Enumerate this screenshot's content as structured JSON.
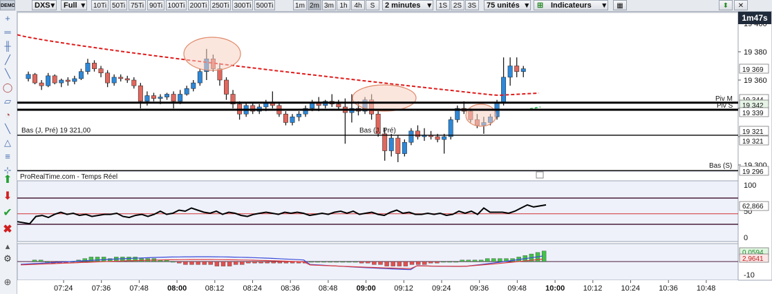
{
  "toolbar": {
    "demo_badge": "DEMO",
    "symbol": "DXS",
    "history": "Full",
    "tick_buttons": [
      "10Ti",
      "50Ti",
      "75Ti",
      "90Ti",
      "100Ti",
      "200Ti",
      "250Ti",
      "300Ti",
      "500Ti"
    ],
    "time_buttons": [
      "1m",
      "2m",
      "3m",
      "1h",
      "4h",
      "S"
    ],
    "active_time": "2m",
    "interval": "2 minutes",
    "second_buttons": [
      "1S",
      "2S",
      "3S"
    ],
    "units": "75 unités",
    "indicators": "Indicateurs"
  },
  "timer": "1m47s",
  "price_panel": {
    "axis_labels": [
      "19 400",
      "19 380",
      "19 360",
      "19 340",
      "19 320",
      "19 300"
    ],
    "tags": [
      "19 369",
      "19 344",
      "19 342",
      "19 339",
      "19 321",
      "19 321",
      "19 296"
    ],
    "levels": {
      "piv_m": {
        "label": "Piv M",
        "value": 19344
      },
      "piv_s": {
        "label": "Piv S",
        "value": 19339
      },
      "bas_j_pre": {
        "label": "Bas (J, Pré) 19 321,00",
        "value": 19321
      },
      "bas_s": {
        "label": "Bas (S)",
        "value": 19296
      }
    },
    "inline_label": "Bas (J, Pré)",
    "colors": {
      "up": "#2d88d8",
      "down": "#e0685e",
      "ma": "#e01a1a",
      "circle_fill": "#f8d2c2",
      "circle_stroke": "#e08a6a"
    }
  },
  "source_label": "ProRealTime.com - Temps Réel",
  "oscillator": {
    "axis_labels": [
      "100",
      "50",
      "0"
    ],
    "value_tag": "62,866",
    "upper": 75,
    "lower": 25,
    "mid": 45,
    "values": [
      30,
      28,
      26,
      40,
      42,
      38,
      44,
      48,
      44,
      46,
      42,
      44,
      40,
      42,
      44,
      44,
      46,
      40,
      38,
      42,
      44,
      40,
      44,
      50,
      44,
      46,
      52,
      50,
      56,
      52,
      48,
      46,
      50,
      44,
      48,
      46,
      42,
      40,
      44,
      46,
      48,
      46,
      44,
      48,
      46,
      48,
      46,
      42,
      44,
      46,
      44,
      48,
      50,
      46,
      50,
      44,
      46,
      48,
      44,
      42,
      48,
      52,
      46,
      48,
      44,
      44,
      46,
      44,
      46,
      42,
      44,
      50,
      46,
      50,
      44,
      56,
      48,
      48,
      48,
      46,
      50,
      56,
      62,
      58,
      60,
      62
    ]
  },
  "macd": {
    "axis_labels": [
      "-10"
    ],
    "tags": [
      "0,0594",
      "2,9641"
    ],
    "histogram": [
      1,
      1,
      0,
      -1,
      -1,
      -1,
      0,
      1,
      2,
      3,
      3,
      3,
      2,
      3,
      3,
      3,
      3,
      2,
      2,
      2,
      1,
      1,
      0,
      -1,
      -2,
      -2,
      -2,
      -2,
      -2,
      -3,
      -3,
      -3,
      -2,
      -2,
      -1,
      -1,
      -1,
      -1,
      -1,
      -1,
      -1,
      -1,
      -1,
      -1,
      0,
      0,
      0,
      0,
      0,
      0,
      0,
      0,
      -1,
      -1,
      -2,
      -2,
      -3,
      -3,
      -3,
      -3,
      -2,
      -2,
      -2,
      -1,
      -1,
      0,
      0,
      0,
      1,
      1,
      1,
      1,
      2,
      2,
      2,
      2,
      2,
      3,
      4,
      5,
      6,
      7
    ]
  },
  "time_axis": [
    "07:24",
    "07:36",
    "07:48",
    "08:00",
    "08:12",
    "08:24",
    "08:36",
    "08:48",
    "09:00",
    "09:12",
    "09:24",
    "09:36",
    "09:48",
    "10:00",
    "10:12",
    "10:24",
    "10:36",
    "10:48"
  ],
  "bold_times": [
    "08:00",
    "09:00",
    "10:00"
  ],
  "candles": [
    [
      19361,
      19366,
      19359,
      19364
    ],
    [
      19364,
      19365,
      19357,
      19358
    ],
    [
      19358,
      19360,
      19353,
      19356
    ],
    [
      19356,
      19365,
      19355,
      19363
    ],
    [
      19363,
      19364,
      19357,
      19358
    ],
    [
      19358,
      19361,
      19355,
      19360
    ],
    [
      19360,
      19362,
      19356,
      19359
    ],
    [
      19359,
      19363,
      19357,
      19361
    ],
    [
      19361,
      19368,
      19360,
      19366
    ],
    [
      19366,
      19375,
      19364,
      19372
    ],
    [
      19372,
      19374,
      19366,
      19368
    ],
    [
      19368,
      19370,
      19362,
      19365
    ],
    [
      19365,
      19367,
      19355,
      19358
    ],
    [
      19358,
      19364,
      19356,
      19362
    ],
    [
      19362,
      19364,
      19359,
      19361
    ],
    [
      19361,
      19363,
      19358,
      19360
    ],
    [
      19360,
      19362,
      19354,
      19356
    ],
    [
      19356,
      19358,
      19340,
      19345
    ],
    [
      19345,
      19352,
      19342,
      19349
    ],
    [
      19349,
      19351,
      19345,
      19347
    ],
    [
      19347,
      19350,
      19343,
      19348
    ],
    [
      19348,
      19351,
      19346,
      19350
    ],
    [
      19350,
      19352,
      19340,
      19345
    ],
    [
      19345,
      19353,
      19343,
      19350
    ],
    [
      19350,
      19356,
      19349,
      19354
    ],
    [
      19354,
      19360,
      19352,
      19358
    ],
    [
      19358,
      19368,
      19356,
      19366
    ],
    [
      19366,
      19382,
      19360,
      19375
    ],
    [
      19375,
      19378,
      19366,
      19368
    ],
    [
      19368,
      19372,
      19356,
      19360
    ],
    [
      19360,
      19362,
      19346,
      19350
    ],
    [
      19350,
      19353,
      19340,
      19343
    ],
    [
      19343,
      19345,
      19332,
      19336
    ],
    [
      19336,
      19344,
      19334,
      19342
    ],
    [
      19342,
      19344,
      19336,
      19338
    ],
    [
      19338,
      19343,
      19336,
      19341
    ],
    [
      19341,
      19346,
      19338,
      19344
    ],
    [
      19344,
      19352,
      19340,
      19342
    ],
    [
      19342,
      19344,
      19334,
      19336
    ],
    [
      19336,
      19338,
      19328,
      19330
    ],
    [
      19330,
      19336,
      19328,
      19334
    ],
    [
      19334,
      19338,
      19331,
      19336
    ],
    [
      19336,
      19342,
      19334,
      19340
    ],
    [
      19340,
      19346,
      19338,
      19344
    ],
    [
      19344,
      19348,
      19338,
      19342
    ],
    [
      19342,
      19346,
      19340,
      19345
    ],
    [
      19345,
      19350,
      19341,
      19343
    ],
    [
      19343,
      19346,
      19339,
      19341
    ],
    [
      19341,
      19347,
      19315,
      19337
    ],
    [
      19337,
      19350,
      19330,
      19340
    ],
    [
      19340,
      19345,
      19335,
      19338
    ],
    [
      19338,
      19348,
      19336,
      19346
    ],
    [
      19346,
      19350,
      19332,
      19336
    ],
    [
      19336,
      19338,
      19320,
      19322
    ],
    [
      19322,
      19326,
      19303,
      19310
    ],
    [
      19310,
      19322,
      19306,
      19319
    ],
    [
      19319,
      19321,
      19302,
      19308
    ],
    [
      19308,
      19318,
      19306,
      19316
    ],
    [
      19316,
      19326,
      19314,
      19324
    ],
    [
      19324,
      19328,
      19318,
      19320
    ],
    [
      19320,
      19326,
      19317,
      19321
    ],
    [
      19321,
      19324,
      19318,
      19320
    ],
    [
      19320,
      19322,
      19316,
      19318
    ],
    [
      19318,
      19322,
      19308,
      19320
    ],
    [
      19320,
      19334,
      19318,
      19332
    ],
    [
      19332,
      19342,
      19330,
      19340
    ],
    [
      19340,
      19345,
      19336,
      19338
    ],
    [
      19338,
      19340,
      19330,
      19332
    ],
    [
      19332,
      19336,
      19326,
      19328
    ],
    [
      19328,
      19334,
      19322,
      19330
    ],
    [
      19330,
      19336,
      19328,
      19334
    ],
    [
      19334,
      19346,
      19332,
      19344
    ],
    [
      19344,
      19376,
      19342,
      19362
    ],
    [
      19362,
      19376,
      19356,
      19370
    ],
    [
      19370,
      19376,
      19362,
      19366
    ],
    [
      19366,
      19370,
      19362,
      19368
    ]
  ]
}
